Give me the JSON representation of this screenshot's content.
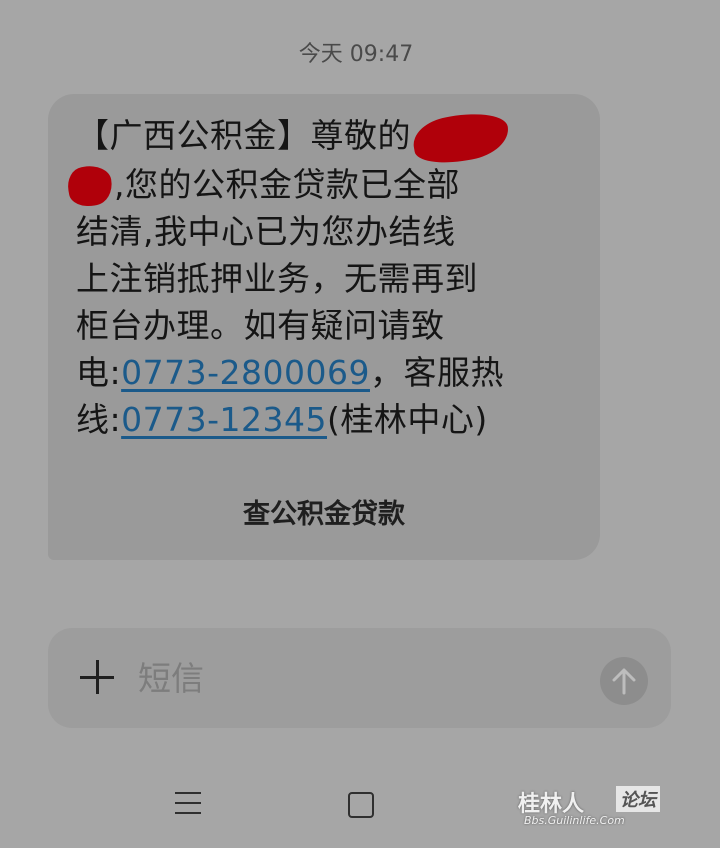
{
  "timestamp": "今天 09:47",
  "message": {
    "line1_prefix": "【广西公积金】尊敬的",
    "line2_after_redact": ",您的公积金贷款已全部",
    "line3": "结清,我中心已为您办结线",
    "line4": "上注销抵押业务，无需再到",
    "line5": "柜台办理。如有疑问请致",
    "phone_prefix": "电:",
    "phone1": "0773-2800069",
    "phone_middle": "，客服热",
    "hotline_prefix": "线:",
    "phone2": "0773-12345",
    "suffix": "(桂林中心)",
    "action_label": "查公积金贷款"
  },
  "composer": {
    "placeholder": "短信",
    "value": ""
  },
  "watermark": {
    "main": "桂林人",
    "tag": "论坛",
    "url": "Bbs.Guilinlife.Com"
  },
  "colors": {
    "background": "#a6a6a6",
    "bubble": "#9a9a9a",
    "link": "#1b5a8a",
    "redaction": "#b0000a"
  },
  "icons": {
    "attach": "plus-icon",
    "send": "arrow-up-icon",
    "nav_recent": "menu-icon",
    "nav_home": "square-icon"
  }
}
